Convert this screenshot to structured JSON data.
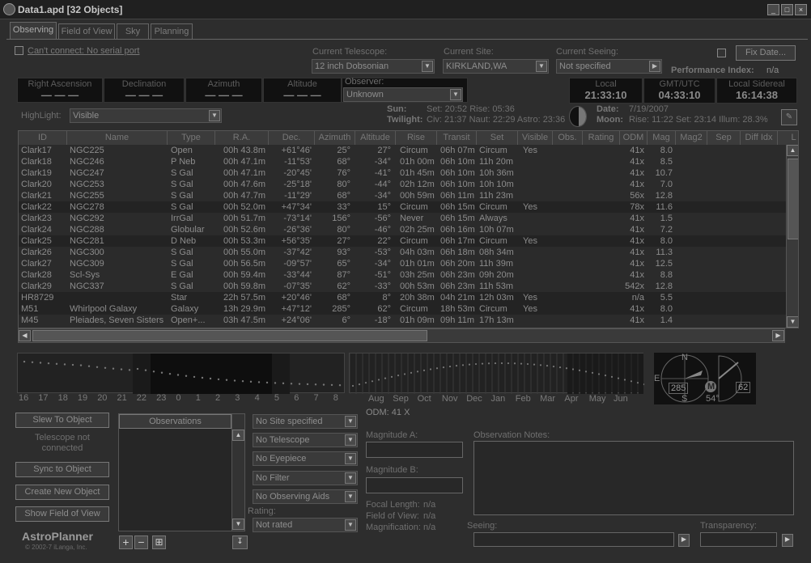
{
  "window": {
    "title": "Data1.apd [32 Objects]"
  },
  "tabs": [
    {
      "label": "Observing"
    },
    {
      "label": "Field of View"
    },
    {
      "label": "Sky"
    },
    {
      "label": "Planning"
    }
  ],
  "connect": {
    "label": "Can't connect: No serial port"
  },
  "telescope": {
    "label": "Current Telescope:",
    "value": "12 inch Dobsonian"
  },
  "site": {
    "label": "Current Site:",
    "value": "KIRKLAND,WA"
  },
  "seeing": {
    "label": "Current Seeing:",
    "value": "Not specified"
  },
  "fixdate": {
    "label": "Fix Date..."
  },
  "perf": {
    "label": "Performance Index:",
    "value": "n/a"
  },
  "coords": [
    {
      "label": "Right Ascension",
      "value": "— — —"
    },
    {
      "label": "Declination",
      "value": "— — —"
    },
    {
      "label": "Azimuth",
      "value": "— — —"
    },
    {
      "label": "Altitude",
      "value": "— — —"
    }
  ],
  "observer": {
    "label": "Observer:",
    "value": "Unknown"
  },
  "times": [
    {
      "label": "Local",
      "value": "21:33:10"
    },
    {
      "label": "GMT/UTC",
      "value": "04:33:10"
    },
    {
      "label": "Local Sidereal",
      "value": "16:14:38"
    }
  ],
  "highlight": {
    "label": "HighLight:",
    "value": "Visible"
  },
  "sun": {
    "label": "Sun:",
    "text": "Set: 20:52  Rise: 05:36"
  },
  "twilight": {
    "label": "Twilight:",
    "text": "Civ: 21:37  Naut: 22:29  Astro: 23:36"
  },
  "date": {
    "label": "Date:",
    "value": "7/19/2007"
  },
  "moon": {
    "label": "Moon:",
    "text": "Rise: 11:22   Set: 23:14   Illum: 28.3%"
  },
  "table": {
    "columns": [
      "ID",
      "Name",
      "Type",
      "R.A.",
      "Dec.",
      "Azimuth",
      "Altitude",
      "Rise",
      "Transit",
      "Set",
      "Visible",
      "Obs.",
      "Rating",
      "ODM",
      "Mag",
      "Mag2",
      "Sep",
      "Diff Idx",
      "L Rating"
    ],
    "rows": [
      [
        "Clark17",
        "NGC225",
        "Open",
        "00h 43.8m",
        "+61°46'",
        "25°",
        "27°",
        "Circum",
        "06h 07m",
        "Circum",
        "Yes",
        "41x",
        "8.0"
      ],
      [
        "Clark18",
        "NGC246",
        "P Neb",
        "00h 47.1m",
        "-11°53'",
        "68°",
        "-34°",
        "01h 00m",
        "06h 10m",
        "11h 20m",
        "",
        "41x",
        "8.5"
      ],
      [
        "Clark19",
        "NGC247",
        "S Gal",
        "00h 47.1m",
        "-20°45'",
        "76°",
        "-41°",
        "01h 45m",
        "06h 10m",
        "10h 36m",
        "",
        "41x",
        "10.7"
      ],
      [
        "Clark20",
        "NGC253",
        "S Gal",
        "00h 47.6m",
        "-25°18'",
        "80°",
        "-44°",
        "02h 12m",
        "06h 10m",
        "10h 10m",
        "",
        "41x",
        "7.0"
      ],
      [
        "Clark21",
        "NGC255",
        "S Gal",
        "00h 47.7m",
        "-11°29'",
        "68°",
        "-34°",
        "00h 59m",
        "06h 11m",
        "11h 23m",
        "",
        "56x",
        "12.8"
      ],
      [
        "Clark22",
        "NGC278",
        "S Gal",
        "00h 52.0m",
        "+47°34'",
        "33°",
        "15°",
        "Circum",
        "06h 15m",
        "Circum",
        "Yes",
        "78x",
        "11.6"
      ],
      [
        "Clark23",
        "NGC292",
        "IrrGal",
        "00h 51.7m",
        "-73°14'",
        "156°",
        "-56°",
        "Never",
        "06h 15m",
        "Always",
        "",
        "41x",
        "1.5"
      ],
      [
        "Clark24",
        "NGC288",
        "Globular",
        "00h 52.6m",
        "-26°36'",
        "80°",
        "-46°",
        "02h 25m",
        "06h 16m",
        "10h 07m",
        "",
        "41x",
        "7.2"
      ],
      [
        "Clark25",
        "NGC281",
        "D Neb",
        "00h 53.3m",
        "+56°35'",
        "27°",
        "22°",
        "Circum",
        "06h 17m",
        "Circum",
        "Yes",
        "41x",
        "8.0"
      ],
      [
        "Clark26",
        "NGC300",
        "S Gal",
        "00h 55.0m",
        "-37°42'",
        "93°",
        "-53°",
        "04h 03m",
        "06h 18m",
        "08h 34m",
        "",
        "41x",
        "11.3"
      ],
      [
        "Clark27",
        "NGC309",
        "S Gal",
        "00h 56.5m",
        "-09°57'",
        "65°",
        "-34°",
        "01h 01m",
        "06h 20m",
        "11h 39m",
        "",
        "41x",
        "12.5"
      ],
      [
        "Clark28",
        "Scl-Sys",
        "E Gal",
        "00h 59.4m",
        "-33°44'",
        "87°",
        "-51°",
        "03h 25m",
        "06h 23m",
        "09h 20m",
        "",
        "41x",
        "8.8"
      ],
      [
        "Clark29",
        "NGC337",
        "S Gal",
        "00h 59.8m",
        "-07°35'",
        "62°",
        "-33°",
        "00h 53m",
        "06h 23m",
        "11h 53m",
        "",
        "542x",
        "12.8"
      ],
      [
        "HR8729",
        "",
        "Star",
        "22h 57.5m",
        "+20°46'",
        "68°",
        "8°",
        "20h 38m",
        "04h 21m",
        "12h 03m",
        "Yes",
        "n/a",
        "5.5"
      ],
      [
        "M51",
        "Whirlpool Galaxy",
        "Galaxy",
        "13h 29.9m",
        "+47°12'",
        "285°",
        "62°",
        "Circum",
        "18h 53m",
        "Circum",
        "Yes",
        "41x",
        "8.0"
      ],
      [
        "M45",
        "Pleiades, Seven Sisters",
        "Open+...",
        "03h 47.5m",
        "+24°06'",
        "6°",
        "-18°",
        "01h 09m",
        "09h 11m",
        "17h 13m",
        "",
        "41x",
        "1.4"
      ]
    ]
  },
  "hours": [
    "16",
    "17",
    "18",
    "19",
    "20",
    "21",
    "22",
    "23",
    "0",
    "1",
    "2",
    "3",
    "4",
    "5",
    "6",
    "7",
    "8"
  ],
  "months": [
    "Aug",
    "Sep",
    "Oct",
    "Nov",
    "Dec",
    "Jan",
    "Feb",
    "Mar",
    "Apr",
    "May",
    "Jun"
  ],
  "compass": {
    "n": "N",
    "s": "S",
    "e": "E",
    "az": "285",
    "alt": "54°",
    "m": "M",
    "v": "62"
  },
  "odm": {
    "label": "ODM: 41 X"
  },
  "buttons": {
    "slew": "Slew To Object",
    "sync": "Sync to Object",
    "create": "Create New Object",
    "fov": "Show Field of View"
  },
  "telstatus": {
    "line1": "Telescope not",
    "line2": "connected"
  },
  "observations": {
    "header": "Observations"
  },
  "obsdd": [
    "No Site specified",
    "No Telescope",
    "No Eyepiece",
    "No Filter",
    "No Observing Aids"
  ],
  "rating": {
    "label": "Rating:",
    "value": "Not rated"
  },
  "magA": {
    "label": "Magnitude A:"
  },
  "magB": {
    "label": "Magnitude B:"
  },
  "optics": [
    {
      "label": "Focal Length:",
      "value": "n/a"
    },
    {
      "label": "Field of View:",
      "value": "n/a"
    },
    {
      "label": "Magnification:",
      "value": "n/a"
    }
  ],
  "notes": {
    "label": "Observation Notes:"
  },
  "seeing2": {
    "label": "Seeing:"
  },
  "transparency": {
    "label": "Transparency:"
  },
  "brand": {
    "name": "AstroPlanner",
    "copy": "© 2002-7 iLanga, Inc."
  },
  "icons": {
    "add": "plus-icon",
    "remove": "minus-icon",
    "addmulti": "plus-multi-icon",
    "import": "import-icon"
  }
}
